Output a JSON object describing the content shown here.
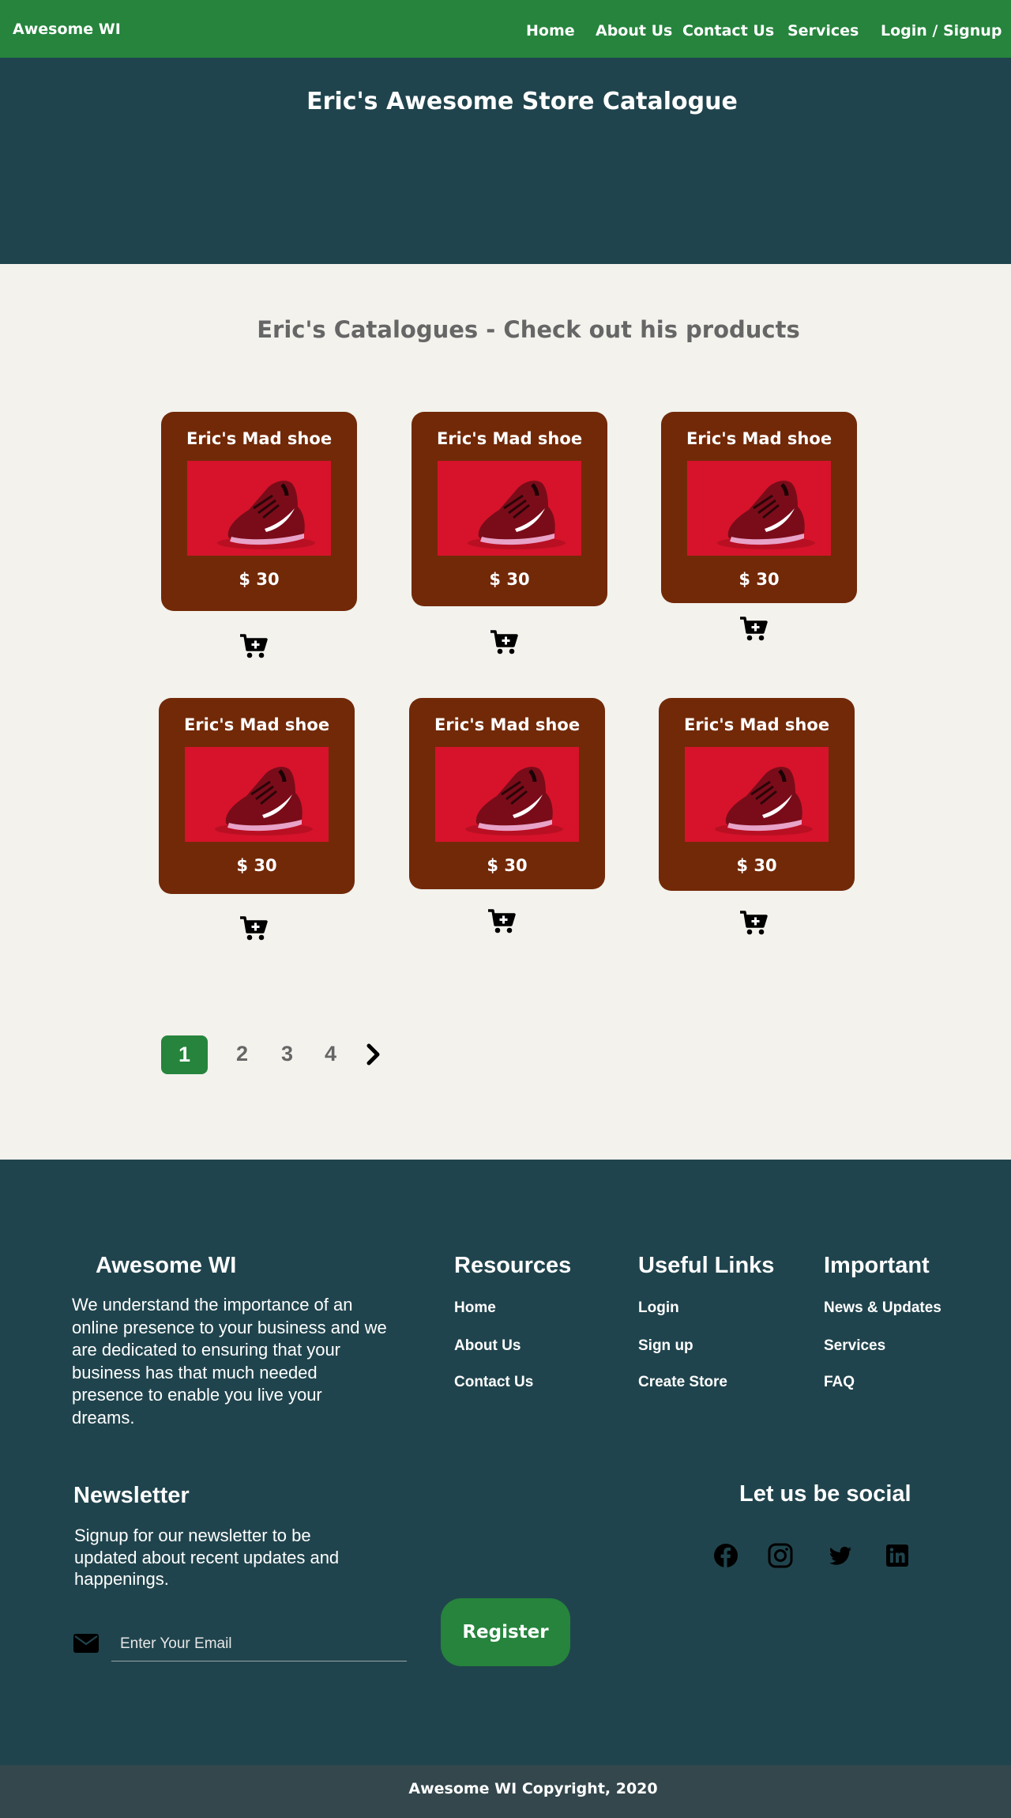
{
  "nav": {
    "brand": "Awesome WI",
    "links": [
      "Home",
      "About Us",
      "Contact Us",
      "Services",
      "Login / Signup"
    ]
  },
  "hero": {
    "title": "Eric's Awesome Store Catalogue"
  },
  "catalogue": {
    "heading": "Eric's Catalogues - Check out his products",
    "products": [
      {
        "name": "Eric's Mad shoe",
        "price": "$ 30",
        "image": "red-sneaker-image",
        "cart_icon": "add-to-cart-icon"
      },
      {
        "name": "Eric's Mad shoe",
        "price": "$ 30",
        "image": "red-sneaker-image",
        "cart_icon": "add-to-cart-icon"
      },
      {
        "name": "Eric's Mad shoe",
        "price": "$ 30",
        "image": "red-sneaker-image",
        "cart_icon": "add-to-cart-icon"
      },
      {
        "name": "Eric's Mad shoe",
        "price": "$ 30",
        "image": "red-sneaker-image",
        "cart_icon": "add-to-cart-icon"
      },
      {
        "name": "Eric's Mad shoe",
        "price": "$ 30",
        "image": "red-sneaker-image",
        "cart_icon": "add-to-cart-icon"
      },
      {
        "name": "Eric's Mad shoe",
        "price": "$ 30",
        "image": "red-sneaker-image",
        "cart_icon": "add-to-cart-icon"
      }
    ]
  },
  "pagination": {
    "pages": [
      "1",
      "2",
      "3",
      "4"
    ],
    "current": "1",
    "next_icon": "chevron-right-icon"
  },
  "footer": {
    "brand": "Awesome WI",
    "about": "We understand the importance of an online presence to your business and we are dedicated to ensuring that your business has that much needed presence to enable you live your dreams.",
    "columns": [
      {
        "title": "Resources",
        "links": [
          "Home",
          "About Us",
          "Contact Us"
        ]
      },
      {
        "title": "Useful Links",
        "links": [
          "Login",
          "Sign up",
          "Create Store"
        ]
      },
      {
        "title": "Important",
        "links": [
          "News & Updates",
          "Services",
          "FAQ"
        ]
      }
    ],
    "newsletter": {
      "title": "Newsletter",
      "text": "Signup for our newsletter to be updated about recent updates and happenings.",
      "placeholder": "Enter Your Email",
      "button": "Register",
      "icon": "envelope-icon"
    },
    "social": {
      "title": "Let us be social",
      "icons": [
        "facebook-icon",
        "instagram-icon",
        "twitter-icon",
        "linkedin-icon"
      ]
    },
    "copyright": "Awesome WI Copyright, 2020"
  },
  "colors": {
    "nav_green": "#26843d",
    "hero_teal": "#20444d",
    "card_brown": "#722908",
    "page_bg": "#f3f2ed",
    "copyright_bar": "#33474c"
  }
}
